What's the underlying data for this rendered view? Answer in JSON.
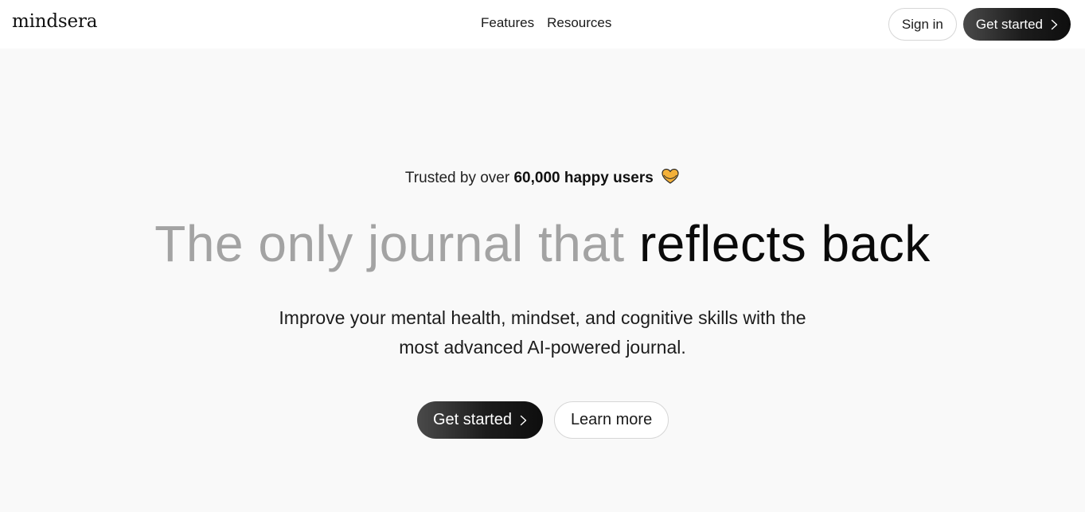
{
  "nav": {
    "logo": "mindsera",
    "links": [
      "Features",
      "Resources"
    ],
    "sign_in": "Sign in",
    "get_started": "Get started"
  },
  "hero": {
    "trusted_prefix": "Trusted by over",
    "trusted_emphasis": "60,000 happy users",
    "trusted_icon": "heart-hands-emoji",
    "headline_muted": "The only journal that",
    "headline_strong": "reflects back",
    "subtitle_line1": "Improve your mental health, mindset, and cognitive skills with the",
    "subtitle_line2": "most advanced AI-powered journal.",
    "cta_primary": "Get started",
    "cta_secondary": "Learn more"
  },
  "colors": {
    "background": "#f9f9f9",
    "navbar": "#ffffff",
    "headline_muted": "#a3a3a3",
    "dark_button": "#1c1c1c"
  }
}
